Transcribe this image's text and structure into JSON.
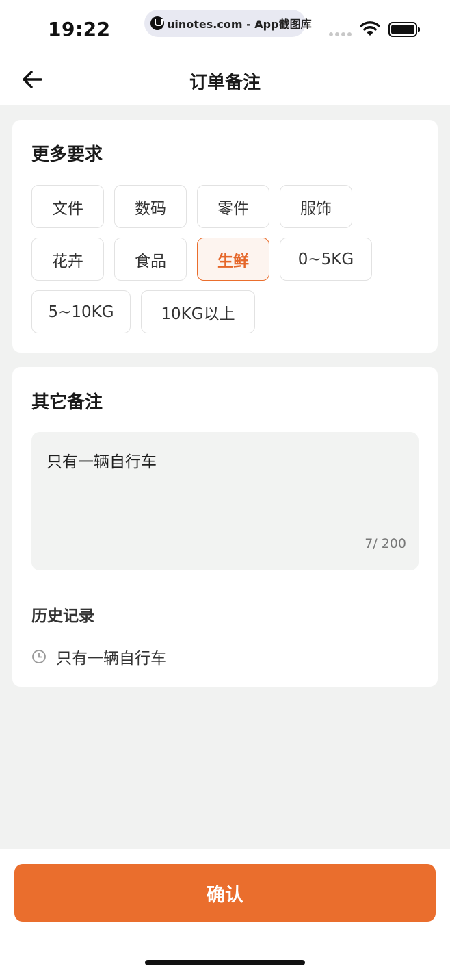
{
  "status_bar": {
    "time": "19:22",
    "watermark": "uinotes.com - App截图库"
  },
  "nav": {
    "title": "订单备注",
    "back_icon": "arrow-left-icon"
  },
  "more_requirements": {
    "title": "更多要求",
    "tags": [
      "文件",
      "数码",
      "零件",
      "服饰",
      "花卉",
      "食品",
      "生鲜",
      "0~5KG",
      "5~10KG",
      "10KG以上"
    ],
    "selected": "生鲜"
  },
  "other_notes": {
    "title": "其它备注",
    "value": "只有一辆自行车",
    "counter": "7/ 200"
  },
  "history": {
    "title": "历史记录",
    "items": [
      "只有一辆自行车"
    ],
    "icon": "clock-icon"
  },
  "footer": {
    "confirm_label": "确认"
  },
  "colors": {
    "accent": "#ea6e2d",
    "accent_bg": "#fdf4ef",
    "page_bg": "#f1f2f1"
  }
}
